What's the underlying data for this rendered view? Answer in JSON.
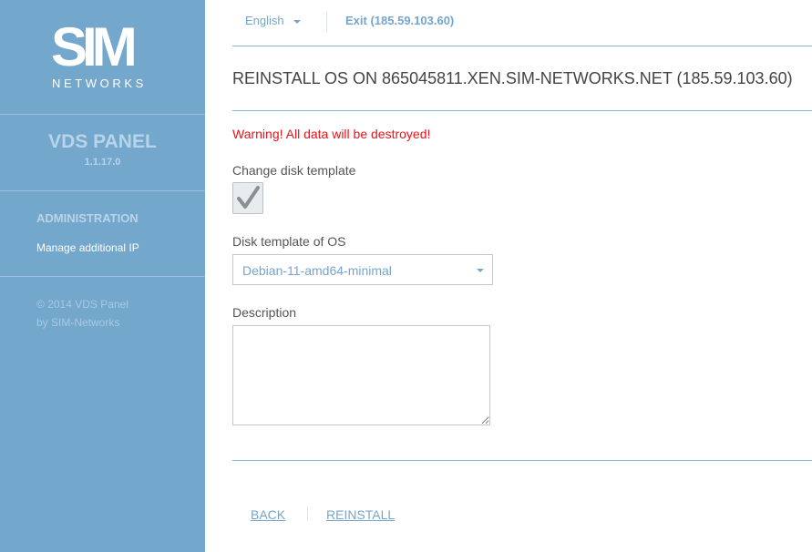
{
  "sidebar": {
    "logo": {
      "main": "SIM",
      "sub": "NETWORKS"
    },
    "panel_title": "VDS PANEL",
    "version": "1.1.17.0",
    "section_title": "ADMINISTRATION",
    "items": [
      {
        "label": "Manage additional IP"
      }
    ],
    "copyright_line1": "© 2014 VDS Panel",
    "copyright_line2": "by SIM-Networks"
  },
  "topbar": {
    "language": "English",
    "exit_label": "Exit (185.59.103.60)"
  },
  "main": {
    "title": "REINSTALL OS ON 865045811.XEN.SIM-NETWORKS.NET (185.59.103.60)",
    "warning": "Warning! All data will be destroyed!",
    "change_template_label": "Change disk template",
    "change_template_checked": true,
    "disk_template_label": "Disk template of OS",
    "disk_template_value": "Debian-11-amd64-minimal",
    "description_label": "Description",
    "description_value": ""
  },
  "actions": {
    "back_label": "BACK",
    "reinstall_label": "REINSTALL"
  },
  "colors": {
    "sidebar_bg": "#73a7cc",
    "accent": "#76a5cc",
    "warning": "#e8141a"
  }
}
